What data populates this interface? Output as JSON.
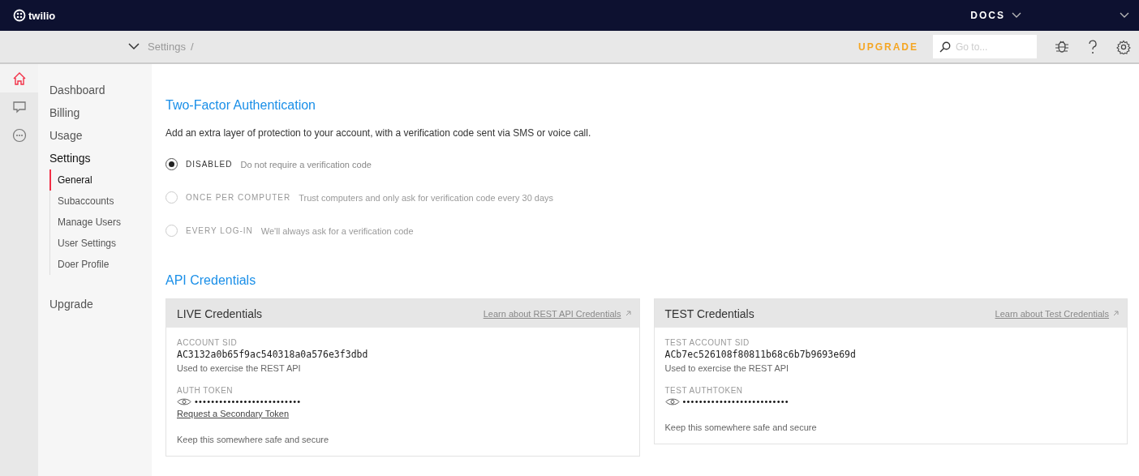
{
  "topbar": {
    "logo": "twilio",
    "docs": "DOCS"
  },
  "subbar": {
    "breadcrumb": "Settings",
    "separator": "/",
    "upgrade": "UPGRADE",
    "search": {
      "placeholder": "Go to..."
    }
  },
  "rail": [
    {
      "kind": "home",
      "selected": true
    },
    {
      "kind": "chat",
      "selected": false
    },
    {
      "kind": "more",
      "selected": false
    }
  ],
  "sidebar": {
    "items": [
      {
        "label": "Dashboard",
        "selected": false
      },
      {
        "label": "Billing",
        "selected": false
      },
      {
        "label": "Usage",
        "selected": false
      },
      {
        "label": "Settings",
        "selected": true,
        "children": [
          {
            "label": "General",
            "selected": true
          },
          {
            "label": "Subaccounts",
            "selected": false
          },
          {
            "label": "Manage Users",
            "selected": false
          },
          {
            "label": "User Settings",
            "selected": false
          },
          {
            "label": "Doer Profile",
            "selected": false
          }
        ]
      },
      {
        "label": "Upgrade",
        "selected": false
      }
    ]
  },
  "two_factor": {
    "title": "Two-Factor Authentication",
    "description": "Add an extra layer of protection to your account, with a verification code sent via SMS or voice call.",
    "options": [
      {
        "label": "DISABLED",
        "hint": "Do not require a verification code",
        "selected": true,
        "disabled": false
      },
      {
        "label": "ONCE PER COMPUTER",
        "hint": "Trust computers and only ask for verification code every 30 days",
        "selected": false,
        "disabled": true
      },
      {
        "label": "EVERY LOG-IN",
        "hint": "We'll always ask for a verification code",
        "selected": false,
        "disabled": true
      }
    ]
  },
  "api": {
    "title": "API Credentials",
    "cards": [
      {
        "title": "LIVE Credentials",
        "link": "Learn about REST API Credentials",
        "sid_label": "ACCOUNT SID",
        "sid": "AC3132a0b65f9ac540318a0a576e3f3dbd",
        "sid_note": "Used to exercise the REST API",
        "token_label": "AUTH TOKEN",
        "token": "••••••••••••••••••••••••••",
        "secondary_link": "Request a Secondary Token",
        "note": "Keep this somewhere safe and secure"
      },
      {
        "title": "TEST Credentials",
        "link": "Learn about Test Credentials",
        "sid_label": "TEST ACCOUNT SID",
        "sid": "ACb7ec526108f80811b68c6b7b9693e69d",
        "sid_note": "Used to exercise the REST API",
        "token_label": "TEST AUTHTOKEN",
        "token": "••••••••••••••••••••••••••",
        "note": "Keep this somewhere safe and secure"
      }
    ]
  }
}
